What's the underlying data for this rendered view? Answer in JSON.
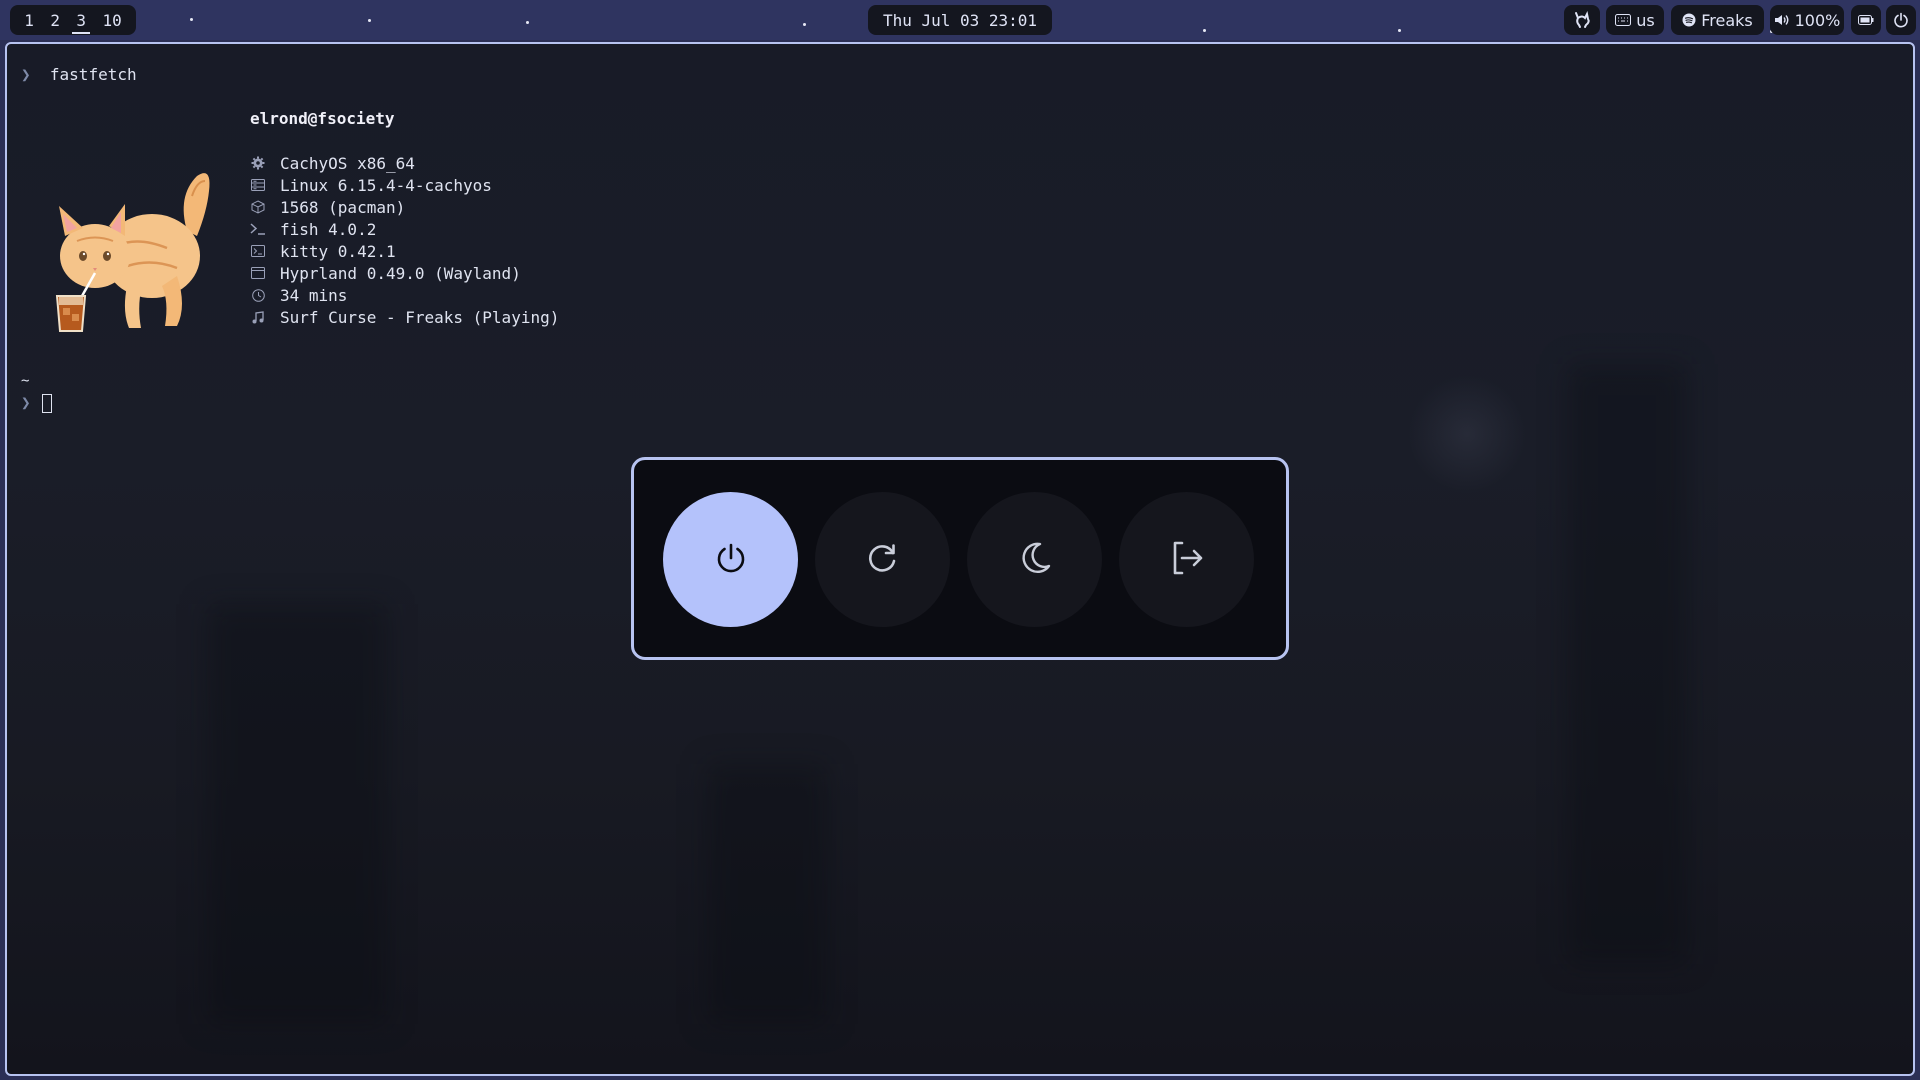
{
  "topbar": {
    "workspaces": [
      "1",
      "2",
      "3",
      "10"
    ],
    "active_workspace": "3",
    "clock": "Thu Jul 03 23:01",
    "keyboard_layout": "us",
    "media_title": "Freaks",
    "volume": "100%",
    "icons": [
      "cat-icon",
      "keyboard-icon",
      "spotify-icon",
      "volume-icon",
      "battery-icon",
      "power-icon"
    ]
  },
  "terminal": {
    "command_prompt": "❯",
    "command": "fastfetch",
    "user_host": "elrond@fsociety",
    "info": [
      {
        "icon": "gear-icon",
        "text": "CachyOS x86_64"
      },
      {
        "icon": "server-icon",
        "text": "Linux 6.15.4-4-cachyos"
      },
      {
        "icon": "package-icon",
        "text": "1568 (pacman)"
      },
      {
        "icon": "shell-prompt-icon",
        "text": "fish 4.0.2"
      },
      {
        "icon": "terminal-icon",
        "text": "kitty 0.42.1"
      },
      {
        "icon": "window-icon",
        "text": "Hyprland 0.49.0 (Wayland)"
      },
      {
        "icon": "clock-icon",
        "text": "34 mins"
      },
      {
        "icon": "music-note-icon",
        "text": "Surf Curse - Freaks (Playing)"
      }
    ],
    "cwd": "~",
    "prompt": "❯"
  },
  "power_menu": {
    "buttons": [
      {
        "name": "shutdown",
        "icon": "power-icon",
        "selected": true
      },
      {
        "name": "reboot",
        "icon": "reboot-icon",
        "selected": false
      },
      {
        "name": "suspend",
        "icon": "moon-icon",
        "selected": false
      },
      {
        "name": "logout",
        "icon": "logout-icon",
        "selected": false
      }
    ]
  },
  "colors": {
    "accent": "#b4c2fb",
    "border": "#b7c3f0",
    "bar_bg": "#2f3460",
    "pill_bg": "#14161f"
  }
}
